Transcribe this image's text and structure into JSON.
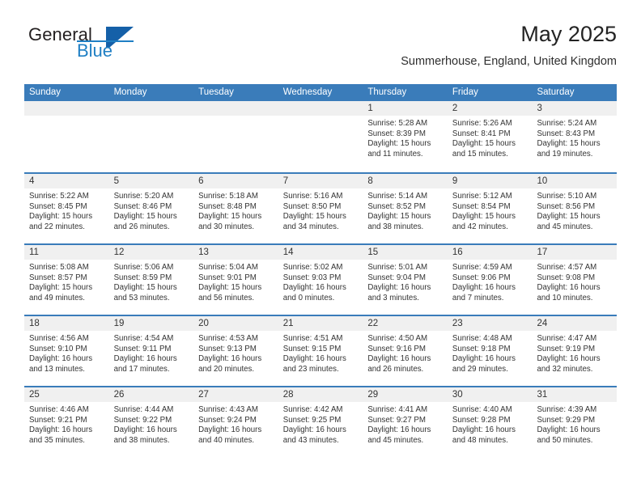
{
  "brand": {
    "name_part1": "General",
    "name_part2": "Blue",
    "logo_icon": "triangle-flag-icon"
  },
  "header": {
    "title": "May 2025",
    "subtitle": "Summerhouse, England, United Kingdom"
  },
  "colors": {
    "header_blue": "#3a7cba",
    "brand_blue": "#1f7fc4",
    "daynum_strip": "#f0f0f0",
    "text": "#333333"
  },
  "weekdays": [
    "Sunday",
    "Monday",
    "Tuesday",
    "Wednesday",
    "Thursday",
    "Friday",
    "Saturday"
  ],
  "weeks": [
    [
      {
        "day": "",
        "empty": true
      },
      {
        "day": "",
        "empty": true
      },
      {
        "day": "",
        "empty": true
      },
      {
        "day": "",
        "empty": true
      },
      {
        "day": "1",
        "sunrise": "Sunrise: 5:28 AM",
        "sunset": "Sunset: 8:39 PM",
        "daylight1": "Daylight: 15 hours",
        "daylight2": "and 11 minutes."
      },
      {
        "day": "2",
        "sunrise": "Sunrise: 5:26 AM",
        "sunset": "Sunset: 8:41 PM",
        "daylight1": "Daylight: 15 hours",
        "daylight2": "and 15 minutes."
      },
      {
        "day": "3",
        "sunrise": "Sunrise: 5:24 AM",
        "sunset": "Sunset: 8:43 PM",
        "daylight1": "Daylight: 15 hours",
        "daylight2": "and 19 minutes."
      }
    ],
    [
      {
        "day": "4",
        "sunrise": "Sunrise: 5:22 AM",
        "sunset": "Sunset: 8:45 PM",
        "daylight1": "Daylight: 15 hours",
        "daylight2": "and 22 minutes."
      },
      {
        "day": "5",
        "sunrise": "Sunrise: 5:20 AM",
        "sunset": "Sunset: 8:46 PM",
        "daylight1": "Daylight: 15 hours",
        "daylight2": "and 26 minutes."
      },
      {
        "day": "6",
        "sunrise": "Sunrise: 5:18 AM",
        "sunset": "Sunset: 8:48 PM",
        "daylight1": "Daylight: 15 hours",
        "daylight2": "and 30 minutes."
      },
      {
        "day": "7",
        "sunrise": "Sunrise: 5:16 AM",
        "sunset": "Sunset: 8:50 PM",
        "daylight1": "Daylight: 15 hours",
        "daylight2": "and 34 minutes."
      },
      {
        "day": "8",
        "sunrise": "Sunrise: 5:14 AM",
        "sunset": "Sunset: 8:52 PM",
        "daylight1": "Daylight: 15 hours",
        "daylight2": "and 38 minutes."
      },
      {
        "day": "9",
        "sunrise": "Sunrise: 5:12 AM",
        "sunset": "Sunset: 8:54 PM",
        "daylight1": "Daylight: 15 hours",
        "daylight2": "and 42 minutes."
      },
      {
        "day": "10",
        "sunrise": "Sunrise: 5:10 AM",
        "sunset": "Sunset: 8:56 PM",
        "daylight1": "Daylight: 15 hours",
        "daylight2": "and 45 minutes."
      }
    ],
    [
      {
        "day": "11",
        "sunrise": "Sunrise: 5:08 AM",
        "sunset": "Sunset: 8:57 PM",
        "daylight1": "Daylight: 15 hours",
        "daylight2": "and 49 minutes."
      },
      {
        "day": "12",
        "sunrise": "Sunrise: 5:06 AM",
        "sunset": "Sunset: 8:59 PM",
        "daylight1": "Daylight: 15 hours",
        "daylight2": "and 53 minutes."
      },
      {
        "day": "13",
        "sunrise": "Sunrise: 5:04 AM",
        "sunset": "Sunset: 9:01 PM",
        "daylight1": "Daylight: 15 hours",
        "daylight2": "and 56 minutes."
      },
      {
        "day": "14",
        "sunrise": "Sunrise: 5:02 AM",
        "sunset": "Sunset: 9:03 PM",
        "daylight1": "Daylight: 16 hours",
        "daylight2": "and 0 minutes."
      },
      {
        "day": "15",
        "sunrise": "Sunrise: 5:01 AM",
        "sunset": "Sunset: 9:04 PM",
        "daylight1": "Daylight: 16 hours",
        "daylight2": "and 3 minutes."
      },
      {
        "day": "16",
        "sunrise": "Sunrise: 4:59 AM",
        "sunset": "Sunset: 9:06 PM",
        "daylight1": "Daylight: 16 hours",
        "daylight2": "and 7 minutes."
      },
      {
        "day": "17",
        "sunrise": "Sunrise: 4:57 AM",
        "sunset": "Sunset: 9:08 PM",
        "daylight1": "Daylight: 16 hours",
        "daylight2": "and 10 minutes."
      }
    ],
    [
      {
        "day": "18",
        "sunrise": "Sunrise: 4:56 AM",
        "sunset": "Sunset: 9:10 PM",
        "daylight1": "Daylight: 16 hours",
        "daylight2": "and 13 minutes."
      },
      {
        "day": "19",
        "sunrise": "Sunrise: 4:54 AM",
        "sunset": "Sunset: 9:11 PM",
        "daylight1": "Daylight: 16 hours",
        "daylight2": "and 17 minutes."
      },
      {
        "day": "20",
        "sunrise": "Sunrise: 4:53 AM",
        "sunset": "Sunset: 9:13 PM",
        "daylight1": "Daylight: 16 hours",
        "daylight2": "and 20 minutes."
      },
      {
        "day": "21",
        "sunrise": "Sunrise: 4:51 AM",
        "sunset": "Sunset: 9:15 PM",
        "daylight1": "Daylight: 16 hours",
        "daylight2": "and 23 minutes."
      },
      {
        "day": "22",
        "sunrise": "Sunrise: 4:50 AM",
        "sunset": "Sunset: 9:16 PM",
        "daylight1": "Daylight: 16 hours",
        "daylight2": "and 26 minutes."
      },
      {
        "day": "23",
        "sunrise": "Sunrise: 4:48 AM",
        "sunset": "Sunset: 9:18 PM",
        "daylight1": "Daylight: 16 hours",
        "daylight2": "and 29 minutes."
      },
      {
        "day": "24",
        "sunrise": "Sunrise: 4:47 AM",
        "sunset": "Sunset: 9:19 PM",
        "daylight1": "Daylight: 16 hours",
        "daylight2": "and 32 minutes."
      }
    ],
    [
      {
        "day": "25",
        "sunrise": "Sunrise: 4:46 AM",
        "sunset": "Sunset: 9:21 PM",
        "daylight1": "Daylight: 16 hours",
        "daylight2": "and 35 minutes."
      },
      {
        "day": "26",
        "sunrise": "Sunrise: 4:44 AM",
        "sunset": "Sunset: 9:22 PM",
        "daylight1": "Daylight: 16 hours",
        "daylight2": "and 38 minutes."
      },
      {
        "day": "27",
        "sunrise": "Sunrise: 4:43 AM",
        "sunset": "Sunset: 9:24 PM",
        "daylight1": "Daylight: 16 hours",
        "daylight2": "and 40 minutes."
      },
      {
        "day": "28",
        "sunrise": "Sunrise: 4:42 AM",
        "sunset": "Sunset: 9:25 PM",
        "daylight1": "Daylight: 16 hours",
        "daylight2": "and 43 minutes."
      },
      {
        "day": "29",
        "sunrise": "Sunrise: 4:41 AM",
        "sunset": "Sunset: 9:27 PM",
        "daylight1": "Daylight: 16 hours",
        "daylight2": "and 45 minutes."
      },
      {
        "day": "30",
        "sunrise": "Sunrise: 4:40 AM",
        "sunset": "Sunset: 9:28 PM",
        "daylight1": "Daylight: 16 hours",
        "daylight2": "and 48 minutes."
      },
      {
        "day": "31",
        "sunrise": "Sunrise: 4:39 AM",
        "sunset": "Sunset: 9:29 PM",
        "daylight1": "Daylight: 16 hours",
        "daylight2": "and 50 minutes."
      }
    ]
  ]
}
